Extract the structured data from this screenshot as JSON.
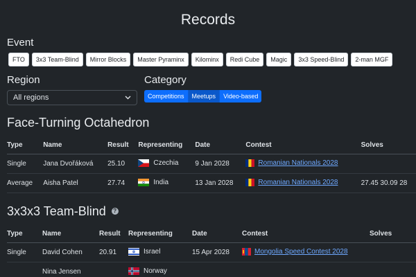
{
  "page": {
    "title": "Records"
  },
  "event": {
    "label": "Event",
    "buttons": [
      "FTO",
      "3x3 Team-Blind",
      "Mirror Blocks",
      "Master Pyraminx",
      "Kilominx",
      "Redi Cube",
      "Magic",
      "3x3 Speed-Blind",
      "2-man MGF"
    ]
  },
  "region": {
    "label": "Region",
    "selected": "All regions"
  },
  "category": {
    "label": "Category",
    "buttons": [
      "Competitions",
      "Meetups",
      "Video-based"
    ]
  },
  "section1": {
    "title": "Face-Turning Octahedron",
    "headers": [
      "Type",
      "Name",
      "Result",
      "Representing",
      "Date",
      "Contest",
      "Solves"
    ],
    "rows": [
      {
        "type": "Single",
        "name": "Jana Dvořáková",
        "result": "25.10",
        "country": "Czechia",
        "date": "9 Jan 2028",
        "contest": "Romanian Nationals 2028",
        "solves": ""
      },
      {
        "type": "Average",
        "name": "Aisha Patel",
        "result": "27.74",
        "country": "India",
        "date": "13 Jan 2028",
        "contest": "Romanian Nationals 2028",
        "solves": "27.45  30.09  28"
      }
    ]
  },
  "section2": {
    "title": "3x3x3 Team-Blind",
    "headers": [
      "Type",
      "Name",
      "Result",
      "Representing",
      "Date",
      "Contest",
      "Solves"
    ],
    "rows": [
      {
        "type": "Single",
        "name": "David Cohen",
        "result": "20.91",
        "country": "Israel",
        "date": "15 Apr 2028",
        "contest": "Mongolia Speed Contest 2028",
        "solves": ""
      },
      {
        "type": "",
        "name": "Nina Jensen",
        "result": "",
        "country": "Norway",
        "date": "",
        "contest": "",
        "solves": ""
      }
    ]
  }
}
